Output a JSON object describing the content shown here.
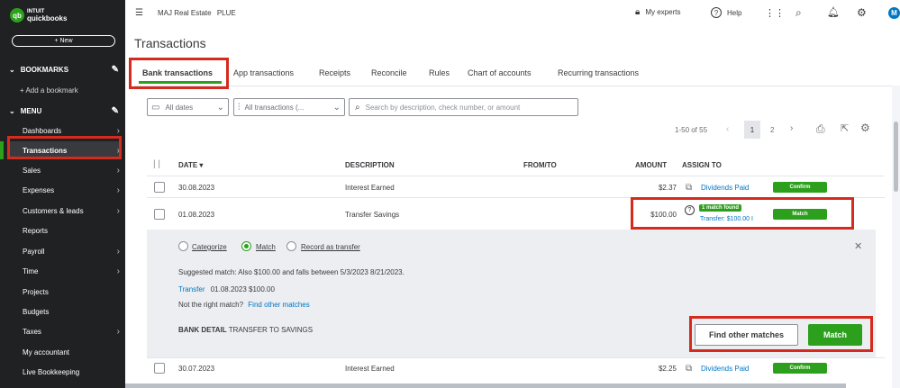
{
  "brand": {
    "mark": "qb",
    "line1": "INTUIT",
    "line2": "quickbooks"
  },
  "sidebar": {
    "new_label": "+ New",
    "bookmarks_label": "BOOKMARKS",
    "add_bookmark": "+ Add a bookmark",
    "menu_label": "MENU",
    "items": [
      {
        "label": "Dashboards",
        "chev": "›"
      },
      {
        "label": "Transactions",
        "chev": "›"
      },
      {
        "label": "Sales",
        "chev": "›"
      },
      {
        "label": "Expenses",
        "chev": "›"
      },
      {
        "label": "Customers & leads",
        "chev": "›"
      },
      {
        "label": "Reports",
        "chev": ""
      },
      {
        "label": "Payroll",
        "chev": "›"
      },
      {
        "label": "Time",
        "chev": "›"
      },
      {
        "label": "Projects",
        "chev": ""
      },
      {
        "label": "Budgets",
        "chev": ""
      },
      {
        "label": "Taxes",
        "chev": "›"
      },
      {
        "label": "My accountant",
        "chev": ""
      },
      {
        "label": "Live Bookkeeping",
        "chev": ""
      }
    ]
  },
  "topbar": {
    "company": "MAJ Real Estate",
    "plan": "PLUE",
    "my_experts": "My experts",
    "help": "Help",
    "avatar": "M"
  },
  "page": {
    "title": "Transactions"
  },
  "tabs": [
    "Bank transactions",
    "App transactions",
    "Receipts",
    "Reconcile",
    "Rules",
    "Chart of accounts",
    "Recurring transactions"
  ],
  "filters": {
    "dates": "All dates",
    "txn": "All transactions (...",
    "search_placeholder": "Search by description, check number, or amount"
  },
  "pager": {
    "range": "1-50 of 55",
    "page1": "1",
    "page2": "2"
  },
  "table": {
    "headers": {
      "date": "DATE ▾",
      "description": "DESCRIPTION",
      "from_to": "FROM/TO",
      "amount": "AMOUNT",
      "assign": "ASSIGN TO"
    },
    "rows": [
      {
        "date": "30.08.2023",
        "description": "Interest Earned",
        "amount": "$2.37",
        "assign": "Dividends Paid",
        "action": "Confirm"
      },
      {
        "date": "01.08.2023",
        "description": "Transfer Savings",
        "amount": "$100.00",
        "badge": "1 match found",
        "assign": "Transfer: $100.00 I",
        "action": "Match"
      },
      {
        "date": "30.07.2023",
        "description": "Interest Earned",
        "amount": "$2.25",
        "assign": "Dividends Paid",
        "action": "Confirm"
      }
    ]
  },
  "detail": {
    "radio_categorize": "Categorize",
    "radio_match": "Match",
    "radio_transfer": "Record as transfer",
    "suggested": "Suggested match: Also $100.00 and falls between 5/3/2023 8/21/2023.",
    "transfer_link": "Transfer",
    "transfer_detail": "01.08.2023 $100.00",
    "not_right": "Not the right match?",
    "find_other_link": "Find other matches",
    "bank_detail_label": "BANK DETAIL",
    "bank_detail_value": "TRANSFER TO SAVINGS",
    "find_other_button": "Find other matches",
    "match_button": "Match",
    "close": "✕"
  },
  "colors": {
    "green": "#2ca01c",
    "sidebar": "#1f2123",
    "highlight": "#d52b1e",
    "link": "#0077c5"
  }
}
